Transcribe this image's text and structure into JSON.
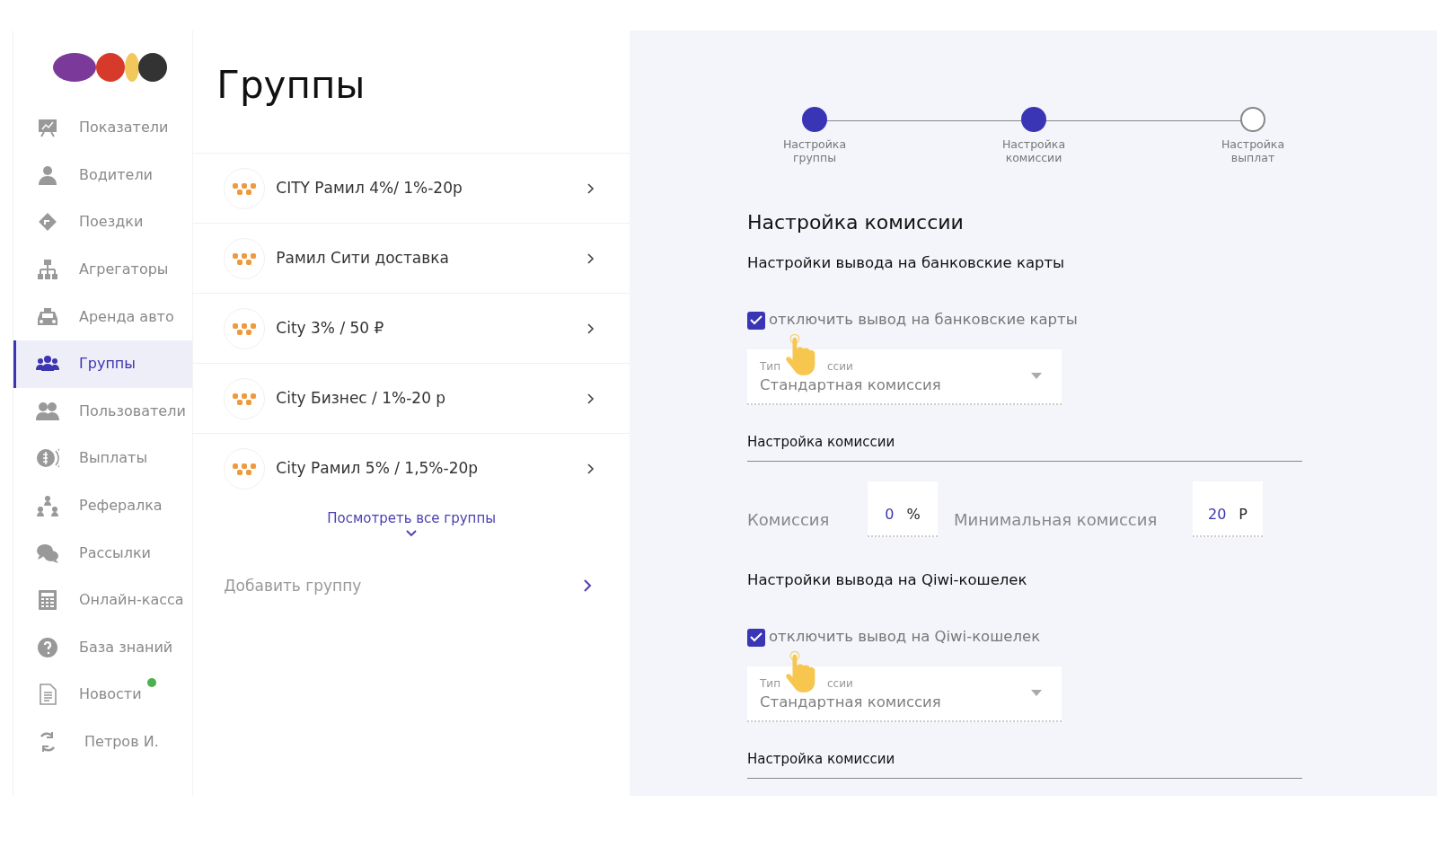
{
  "sidebar": {
    "items": [
      {
        "label": "Показатели",
        "selected": false,
        "notification": false
      },
      {
        "label": "Водители",
        "selected": false,
        "notification": false
      },
      {
        "label": "Поездки",
        "selected": false,
        "notification": false
      },
      {
        "label": "Агрегаторы",
        "selected": false,
        "notification": false
      },
      {
        "label": "Аренда авто",
        "selected": false,
        "notification": false
      },
      {
        "label": "Группы",
        "selected": true,
        "notification": false
      },
      {
        "label": "Пользователи",
        "selected": false,
        "notification": false
      },
      {
        "label": "Выплаты",
        "selected": false,
        "notification": false
      },
      {
        "label": "Рефералка",
        "selected": false,
        "notification": false
      },
      {
        "label": "Рассылки",
        "selected": false,
        "notification": false
      },
      {
        "label": "Онлайн-касса",
        "selected": false,
        "notification": false
      },
      {
        "label": "База знаний",
        "selected": false,
        "notification": false
      },
      {
        "label": "Новости",
        "selected": false,
        "notification": true
      },
      {
        "label": "Петров И.",
        "selected": false,
        "notification": false
      }
    ]
  },
  "page_title": "Группы",
  "groups": [
    {
      "name": "CITY Рамил 4%/ 1%-20р"
    },
    {
      "name": "Рамил Сити доставка"
    },
    {
      "name": "City 3% / 50 ₽"
    },
    {
      "name": "City Бизнес / 1%-20 р"
    },
    {
      "name": "City Рамил 5% / 1,5%-20р"
    }
  ],
  "show_all": "Посмотреть все группы",
  "add_group": "Добавить группу",
  "stepper": [
    {
      "label": "Настройка группы",
      "completed": true
    },
    {
      "label": "Настройка комиссии",
      "completed": true
    },
    {
      "label": "Настройка выплат",
      "completed": false
    }
  ],
  "form_title": "Настройка комиссии",
  "sections": [
    {
      "title": "Настройки вывода на банковские карты",
      "checkbox": {
        "label": "отключить вывод на банковские карты",
        "checked": true
      },
      "pointer": true,
      "select": {
        "label_parts": [
          "Тип",
          "ссии"
        ],
        "value": "Стандартная комиссия"
      },
      "subheading": "Настройка комиссии",
      "fields": [
        {
          "label": "Комиссия",
          "value": "0",
          "unit": "%"
        },
        {
          "label": "Минимальная комиссия",
          "value": "20",
          "unit": "Р"
        }
      ]
    },
    {
      "title": "Настройки вывода на Qiwi-кошелек",
      "checkbox": {
        "label": "отключить вывод на Qiwi-кошелек",
        "checked": true
      },
      "pointer": true,
      "select": {
        "label_parts": [
          "Тип",
          "ссии"
        ],
        "value": "Стандартная комиссия"
      },
      "subheading": "Настройка комиссии"
    }
  ]
}
